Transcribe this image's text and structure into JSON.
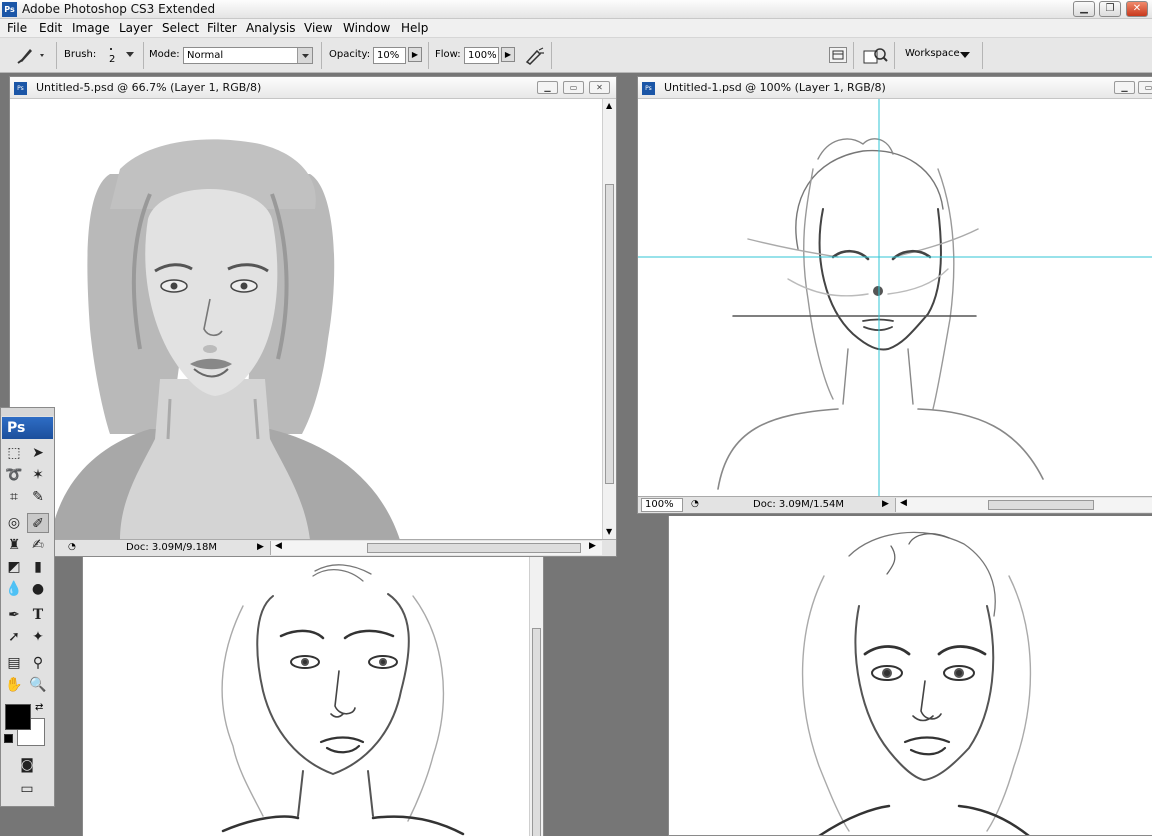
{
  "app": {
    "title": "Adobe Photoshop CS3 Extended",
    "logo": "Ps"
  },
  "menu": [
    "File",
    "Edit",
    "Image",
    "Layer",
    "Select",
    "Filter",
    "Analysis",
    "View",
    "Window",
    "Help"
  ],
  "options": {
    "brush_label": "Brush:",
    "brush_size": "2",
    "mode_label": "Mode:",
    "mode_value": "Normal",
    "opacity_label": "Opacity:",
    "opacity_value": "10%",
    "flow_label": "Flow:",
    "flow_value": "100%",
    "workspace_label": "Workspace"
  },
  "documents": [
    {
      "title": "Untitled-5.psd @ 66.7% (Layer 1, RGB/8)",
      "doc_info": "Doc: 3.09M/9.18M",
      "zoom": ""
    },
    {
      "title": "Untitled-1.psd @ 100% (Layer 1, RGB/8)",
      "doc_info": "Doc: 3.09M/1.54M",
      "zoom": "100%"
    }
  ],
  "toolbox": {
    "logo": "Ps"
  },
  "icons": {
    "brush": "brush-icon",
    "airbrush": "airbrush-icon",
    "palette": "palette-well-icon",
    "bridge": "bridge-icon"
  }
}
